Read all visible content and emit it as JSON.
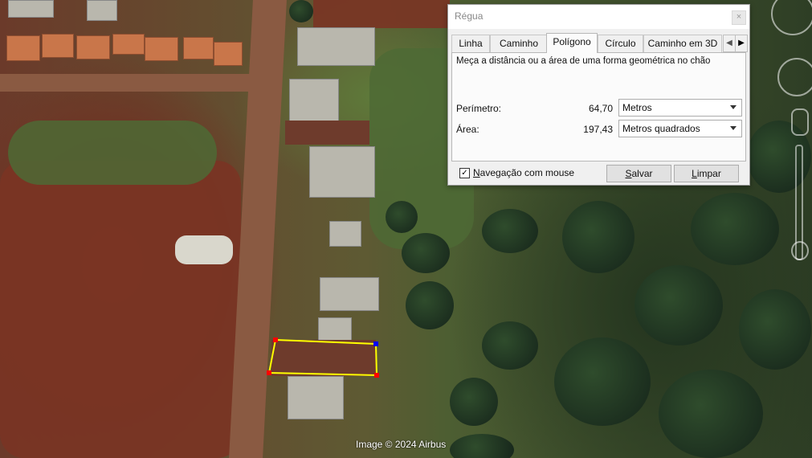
{
  "map": {
    "attribution": "Image © 2024 Airbus"
  },
  "ruler": {
    "title": "Régua",
    "close_glyph": "×",
    "tabs": [
      "Linha",
      "Caminho",
      "Polígono",
      "Círculo",
      "Caminho em 3D"
    ],
    "active_tab": "Polígono",
    "tab_prev_glyph": "◀",
    "tab_next_glyph": "▶",
    "description": "Meça a distância ou a área de uma forma geométrica no chão",
    "perimeter": {
      "label": "Perímetro:",
      "value": "64,70",
      "unit": "Metros"
    },
    "area": {
      "label": "Área:",
      "value": "197,43",
      "unit": "Metros quadrados"
    },
    "mouse_nav": {
      "label": "Navegação com mouse",
      "checked": true,
      "check_glyph": "✓"
    },
    "save_label": "Salvar",
    "clear_label": "Limpar"
  },
  "colors": {
    "polygon_stroke": "#ffff00",
    "vertex": "#ff0000",
    "active_vertex": "#0000ff"
  }
}
